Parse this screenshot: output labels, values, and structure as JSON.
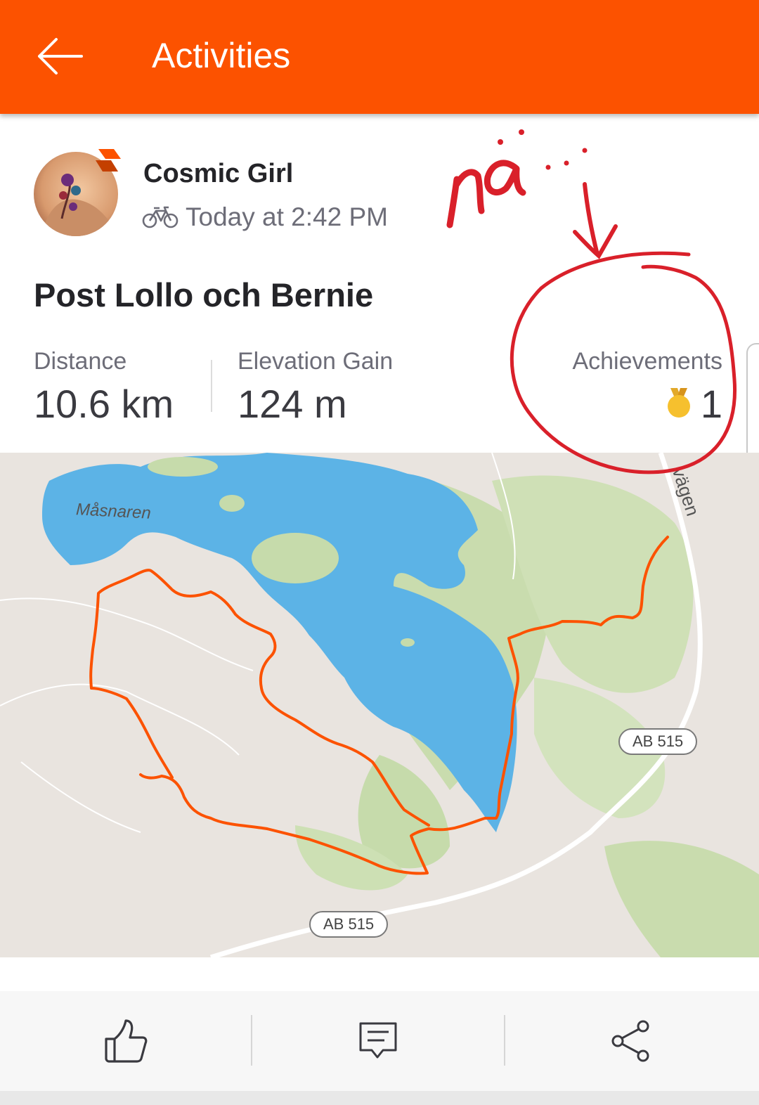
{
  "header": {
    "title": "Activities"
  },
  "activity": {
    "athlete_name": "Cosmic Girl",
    "timestamp": "Today at 2:42 PM",
    "title": "Post Lollo och Bernie",
    "stats": {
      "distance_label": "Distance",
      "distance_value": "10.6 km",
      "elevation_label": "Elevation Gain",
      "elevation_value": "124 m",
      "achievements_label": "Achievements",
      "achievements_value": "1"
    }
  },
  "map": {
    "lake_label": "Måsnaren",
    "street_label": "vägen",
    "road_badge_1": "AB 515",
    "road_badge_2": "AB 515"
  },
  "annotation": {
    "handwriting": "nä ..."
  },
  "colors": {
    "brand": "#fc5200",
    "route": "#fc5200",
    "water": "#5cb3e6",
    "park": "#c9dcae",
    "annotation": "#d9202a",
    "medal": "#f6c02e"
  }
}
